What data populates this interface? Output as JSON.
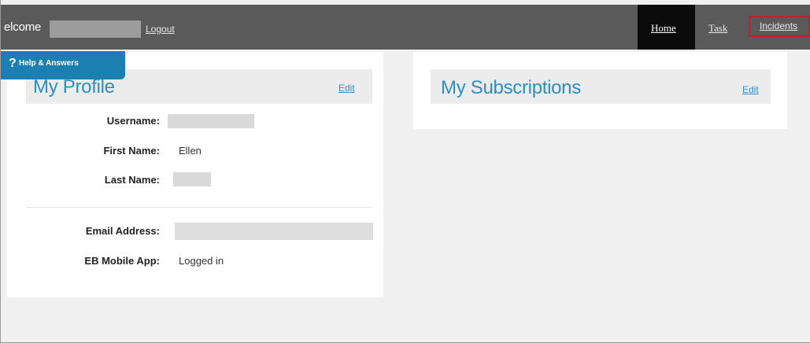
{
  "header": {
    "welcome_text": "elcome",
    "logout_label": "Logout",
    "nav": [
      {
        "label": "Home",
        "active": true
      },
      {
        "label": "Task",
        "active": false
      },
      {
        "label": "Incidents",
        "active": false,
        "highlighted": true
      }
    ]
  },
  "help": {
    "icon": "question-mark-icon",
    "icon_glyph": "?",
    "label": "Help & Answers"
  },
  "profile": {
    "title": "My Profile",
    "edit_label": "Edit",
    "fields": [
      {
        "label": "Username:",
        "value": ""
      },
      {
        "label": "First Name:",
        "value": "Ellen"
      },
      {
        "label": "Last Name:",
        "value": ""
      },
      {
        "label": "Email Address:",
        "value": ""
      },
      {
        "label": "EB Mobile App:",
        "value": "Logged in"
      }
    ]
  },
  "subscriptions": {
    "title": "My Subscriptions",
    "edit_label": "Edit"
  },
  "colors": {
    "topbar": "#5a5a5a",
    "active_nav": "#0b0b0b",
    "accent_blue": "#2b8fc0",
    "help_tab": "#1b7fb1",
    "highlight_red": "#c21f2a"
  }
}
